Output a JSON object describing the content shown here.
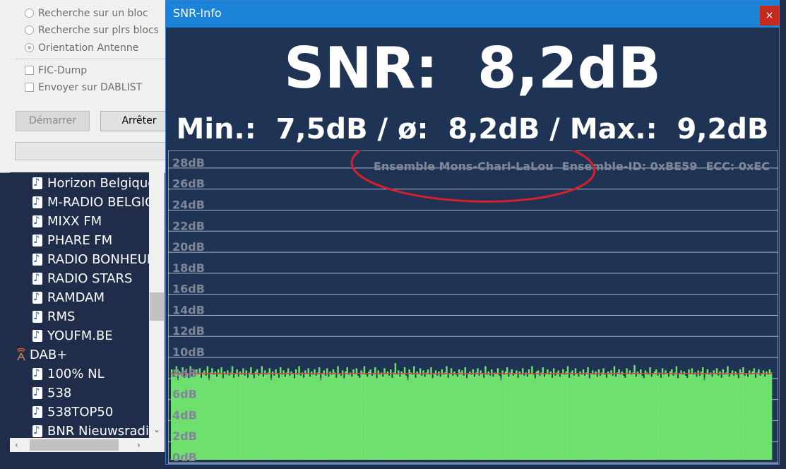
{
  "dialog": {
    "options": [
      {
        "label": "Recherche sur un bloc",
        "selected": false
      },
      {
        "label": "Recherche sur plrs blocs",
        "selected": false
      },
      {
        "label": "Orientation Antenne",
        "selected": true
      }
    ],
    "checkboxes": [
      {
        "label": "FIC-Dump",
        "checked": false
      },
      {
        "label": "Envoyer sur DABLIST",
        "checked": false
      }
    ],
    "start_label": "Démarrer",
    "stop_label": "Arrêter"
  },
  "tree": {
    "stations_top": [
      "Horizon Belgique",
      "M-RADIO BELGIQUE",
      "MIXX FM",
      "PHARE FM",
      "RADIO BONHEUR",
      "RADIO STARS",
      "RAMDAM",
      "RMS",
      "YOUFM.BE"
    ],
    "group_label": "DAB+",
    "stations_bottom": [
      "100% NL",
      "538",
      "538TOP50",
      "BNR Nieuwsradio"
    ]
  },
  "window": {
    "title": "SNR-Info",
    "close_glyph": "×"
  },
  "snr": {
    "main_label": "SNR:",
    "main_value": "8,2dB",
    "min_label": "Min.:",
    "min_value": "7,5dB",
    "avg_label": "ø:",
    "avg_value": "8,2dB",
    "max_label": "Max.:",
    "max_value": "9,2dB"
  },
  "colors": {
    "window_bg": "#1f3354",
    "titlebar": "#1b83d7",
    "bar_fill": "#6ee06e",
    "avg_line": "#d24a4a",
    "annotation": "#d8202a",
    "grid": "#d8dde8",
    "axis_text": "#7f8796"
  },
  "chart_data": {
    "type": "bar",
    "ylabels": [
      "28dB",
      "26dB",
      "24dB",
      "22dB",
      "20dB",
      "18dB",
      "16dB",
      "14dB",
      "12dB",
      "10dB",
      "8dB",
      "6dB",
      "4dB",
      "2dB",
      "0dB"
    ],
    "ylim": [
      0,
      29
    ],
    "ensemble_name": "Ensemble Mons-Charl-LaLou",
    "ensemble_id": "Ensemble-ID: 0xBE59",
    "ecc": "ECC: 0xEC",
    "avg": 8.2,
    "min": 7.5,
    "max": 9.2,
    "values": [
      8.6,
      7.9,
      8.3,
      8.9,
      7.6,
      8.4,
      8.1,
      8.8,
      7.8,
      8.5,
      8.2,
      7.7,
      8.9,
      8.0,
      8.4,
      7.9,
      8.6,
      8.2,
      8.7,
      7.8,
      8.3,
      8.5,
      8.0,
      8.9,
      7.6,
      8.3,
      8.7,
      8.1,
      8.4,
      7.9,
      8.6,
      8.2,
      8.8,
      7.7,
      8.4,
      8.1,
      8.5,
      8.0,
      8.3,
      8.9,
      7.8,
      8.2,
      8.6,
      7.9,
      8.4,
      8.1,
      8.7,
      8.0,
      8.5,
      7.8,
      8.3,
      8.8,
      8.1,
      7.7,
      8.4,
      8.6,
      8.0,
      8.2,
      8.9,
      7.9,
      8.5,
      8.1,
      8.3,
      8.7,
      7.6,
      8.4,
      8.0,
      8.6,
      8.2,
      7.8,
      8.8,
      8.1,
      8.5,
      7.9,
      8.3,
      8.7,
      8.0,
      8.4,
      8.2,
      7.7,
      8.6,
      8.1,
      8.9,
      8.0,
      8.3,
      7.8,
      8.5,
      8.2,
      8.7,
      7.9,
      8.4,
      8.1,
      8.6,
      8.0,
      8.3,
      8.8,
      7.6,
      8.2,
      8.5,
      8.0,
      8.7,
      7.9,
      8.4,
      8.1,
      8.6,
      8.3,
      7.8,
      8.9,
      8.2,
      8.0,
      8.5,
      7.7,
      8.4,
      8.8,
      8.1,
      8.3,
      7.9,
      8.6,
      8.2,
      8.7,
      8.0,
      7.8,
      8.5,
      8.3,
      8.9,
      8.1,
      7.9,
      8.4,
      8.6,
      8.0,
      8.2,
      8.8,
      7.7,
      8.5,
      8.1,
      8.3,
      7.9,
      8.7,
      8.2,
      8.4,
      8.0,
      8.6,
      7.8,
      8.3,
      9.2,
      8.1,
      8.5,
      7.9,
      8.4,
      8.2,
      8.8,
      8.0,
      7.6,
      8.6,
      8.3,
      8.1,
      8.9,
      7.8,
      8.4,
      8.2,
      8.7,
      8.0,
      8.5,
      7.9,
      8.3,
      8.6,
      8.1,
      8.8,
      7.7,
      8.2,
      8.5,
      8.0,
      8.4,
      7.9,
      8.6,
      8.1,
      8.3,
      8.9,
      7.8,
      8.2,
      8.7,
      8.0,
      8.4,
      8.1,
      7.9,
      8.6,
      8.3,
      8.5,
      8.0,
      8.8,
      7.7,
      8.2,
      8.4,
      8.1,
      8.6,
      7.9,
      8.3,
      8.7,
      8.0,
      8.5,
      8.2,
      7.8,
      8.9,
      8.1,
      8.4,
      8.0,
      8.6,
      7.9,
      8.3,
      8.2,
      8.7,
      8.0,
      7.6,
      8.5,
      8.1,
      8.4,
      8.8,
      7.9,
      8.3,
      8.6,
      8.0,
      8.2,
      8.5,
      7.8,
      8.4,
      8.1,
      8.7,
      8.0,
      8.3,
      7.9,
      8.6,
      8.2,
      8.9,
      8.1,
      7.7,
      8.4,
      8.5,
      8.0,
      8.3,
      8.8,
      7.9,
      8.2,
      8.6,
      8.1,
      8.4,
      7.8,
      8.7,
      8.0,
      8.3,
      8.5,
      7.9,
      8.2,
      8.6,
      8.1,
      8.4,
      8.9,
      7.8,
      8.3,
      8.5,
      8.0,
      8.7,
      8.2,
      7.9,
      8.4,
      8.1,
      8.6,
      8.0,
      8.3,
      8.8,
      7.7,
      8.2,
      8.5,
      8.1,
      8.4,
      7.9,
      8.6,
      8.0,
      8.3,
      8.7,
      8.1,
      7.8,
      8.4,
      8.2,
      8.5,
      8.0,
      8.9,
      7.9,
      8.3,
      8.6,
      8.1,
      8.4,
      8.0,
      7.8,
      8.7,
      8.2,
      8.5,
      8.1,
      8.3,
      9.0,
      7.9,
      8.4,
      8.2,
      8.6,
      8.0,
      7.7,
      8.5,
      8.3,
      8.1,
      8.8,
      7.9,
      8.2,
      8.4,
      8.6,
      8.0,
      8.3,
      7.8,
      8.7,
      8.1,
      8.5,
      8.2,
      7.9,
      8.4,
      8.6,
      8.0,
      8.3,
      8.9,
      7.7,
      8.2,
      8.5,
      8.1,
      8.4,
      8.0,
      7.8,
      8.6,
      8.2,
      8.7,
      8.1,
      8.3,
      7.9,
      8.5,
      8.0,
      8.4,
      8.8,
      7.6,
      8.2,
      8.6,
      8.1,
      8.3,
      7.9,
      8.5,
      8.2,
      8.7,
      8.0,
      8.4,
      7.8,
      8.6,
      8.1,
      8.3,
      8.9,
      7.9,
      8.2,
      8.5,
      8.0,
      8.4,
      8.1,
      7.7,
      8.6,
      8.3,
      8.8,
      8.0,
      8.2,
      7.9,
      8.5,
      8.1,
      8.4,
      8.7,
      7.8,
      8.3,
      8.6,
      8.0,
      8.2,
      8.5,
      7.9,
      8.4,
      8.1,
      8.6,
      8.3
    ]
  }
}
